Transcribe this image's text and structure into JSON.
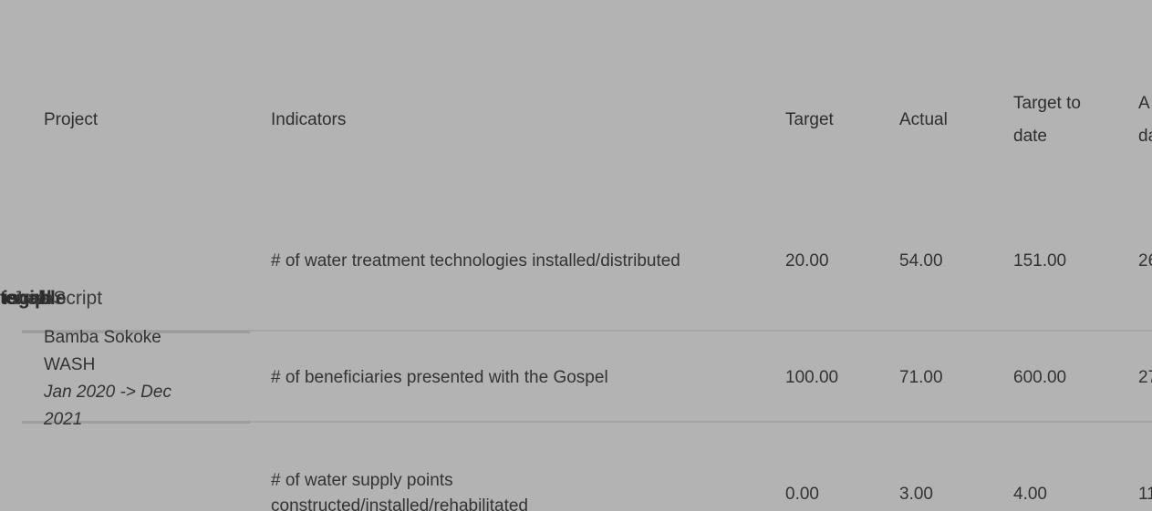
{
  "table": {
    "headers": {
      "project": "Project",
      "indicators": "Indicators",
      "target": "Target",
      "actual": "Actual",
      "target_to_date_line1": "Target to",
      "target_to_date_line2": "date",
      "actual_to_date_line1": "A",
      "actual_to_date_line2": "da"
    },
    "project": {
      "name": "Bamba Sokoke WASH",
      "dates": "Jan 2020 -> Dec 2021"
    },
    "rows": [
      {
        "indicator": "# of water treatment technologies installed/distributed",
        "target": "20.00",
        "actual": "54.00",
        "target_to_date": "151.00",
        "actual_to_date": "26"
      },
      {
        "indicator": "# of beneficiaries presented with the Gospel",
        "target": "100.00",
        "actual": "71.00",
        "target_to_date": "600.00",
        "actual_to_date": "27"
      },
      {
        "indicator": "# of water supply points constructed/installed/rehabilitated",
        "target": "0.00",
        "actual": "3.00",
        "target_to_date": "4.00",
        "actual_to_date": "11"
      }
    ]
  },
  "overlapping_text": {
    "script_label": "JavaScript",
    "fragment_a": "togal",
    "fragment_b": "iscipl",
    "fragment_c": "enable"
  }
}
